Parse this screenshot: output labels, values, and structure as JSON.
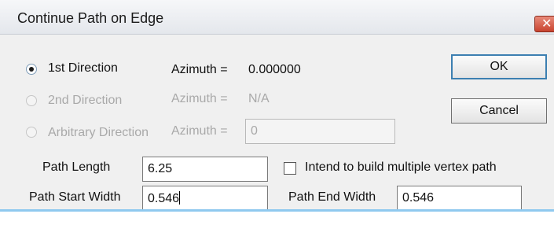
{
  "window": {
    "title": "Continue Path on Edge",
    "close_symbol": "✕",
    "close_icon": "close-icon"
  },
  "direction_options": [
    {
      "label": "1st Direction",
      "selected": true,
      "enabled": true,
      "azimuth_label": "Azimuth =",
      "azimuth_value": "0.000000"
    },
    {
      "label": "2nd Direction",
      "selected": false,
      "enabled": false,
      "azimuth_label": "Azimuth =",
      "azimuth_value": "N/A"
    },
    {
      "label": "Arbitrary Direction",
      "selected": false,
      "enabled": false,
      "azimuth_label": "Azimuth =",
      "azimuth_value": "0"
    }
  ],
  "buttons": {
    "ok_label": "OK",
    "cancel_label": "Cancel"
  },
  "path": {
    "length_label": "Path Length",
    "length_value": "6.25",
    "start_width_label": "Path Start Width",
    "start_width_value": "0.546",
    "end_width_label": "Path End Width",
    "end_width_value": "0.546",
    "multi_vertex_label": "Intend to build multiple vertex path",
    "multi_vertex_checked": false
  },
  "colors": {
    "dialog_background": "#f0f0f0",
    "default_button_border": "#3c7fb1",
    "disabled_text": "#a9a9a9",
    "close_button": "#c8432f"
  }
}
